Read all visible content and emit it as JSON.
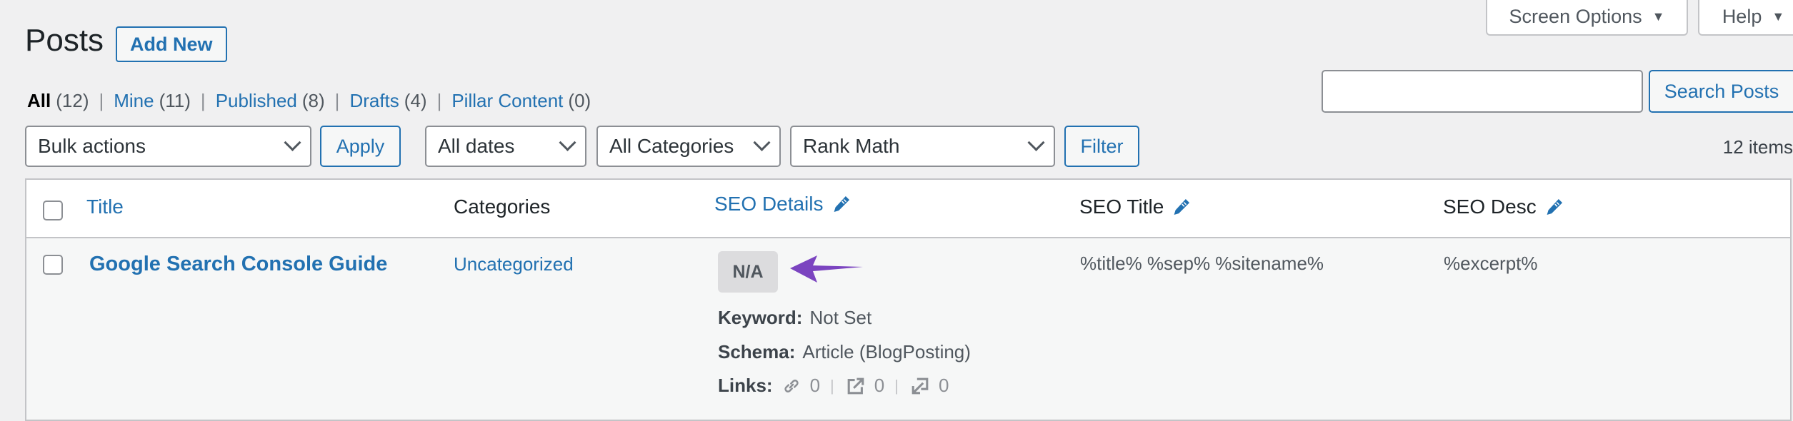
{
  "screen_meta": {
    "screen_options_label": "Screen Options",
    "help_label": "Help"
  },
  "header": {
    "title": "Posts",
    "add_new_label": "Add New"
  },
  "views": [
    {
      "label": "All",
      "count": "(12)",
      "current": true
    },
    {
      "label": "Mine",
      "count": "(11)"
    },
    {
      "label": "Published",
      "count": "(8)"
    },
    {
      "label": "Drafts",
      "count": "(4)"
    },
    {
      "label": "Pillar Content",
      "count": "(0)"
    }
  ],
  "search": {
    "value": "",
    "button_label": "Search Posts"
  },
  "filters": {
    "bulk_actions": "Bulk actions",
    "apply_label": "Apply",
    "dates": "All dates",
    "categories": "All Categories",
    "seo_filter": "Rank Math",
    "filter_label": "Filter",
    "items_count": "12 items"
  },
  "table": {
    "columns": {
      "title": "Title",
      "categories": "Categories",
      "seo_details": "SEO Details",
      "seo_title": "SEO Title",
      "seo_desc": "SEO Desc"
    },
    "rows": [
      {
        "title": "Google Search Console Guide",
        "category": "Uncategorized",
        "seo_score": "N/A",
        "keyword_label": "Keyword:",
        "keyword_value": "Not Set",
        "schema_label": "Schema:",
        "schema_value": "Article (BlogPosting)",
        "links_label": "Links:",
        "links_internal": "0",
        "links_external": "0",
        "links_incoming": "0",
        "seo_title": "%title% %sep% %sitename%",
        "seo_desc": "%excerpt%"
      }
    ]
  },
  "annotation": {
    "arrow_color": "#7b44c0"
  },
  "colors": {
    "accent": "#2271b1",
    "background": "#f0f0f1"
  }
}
